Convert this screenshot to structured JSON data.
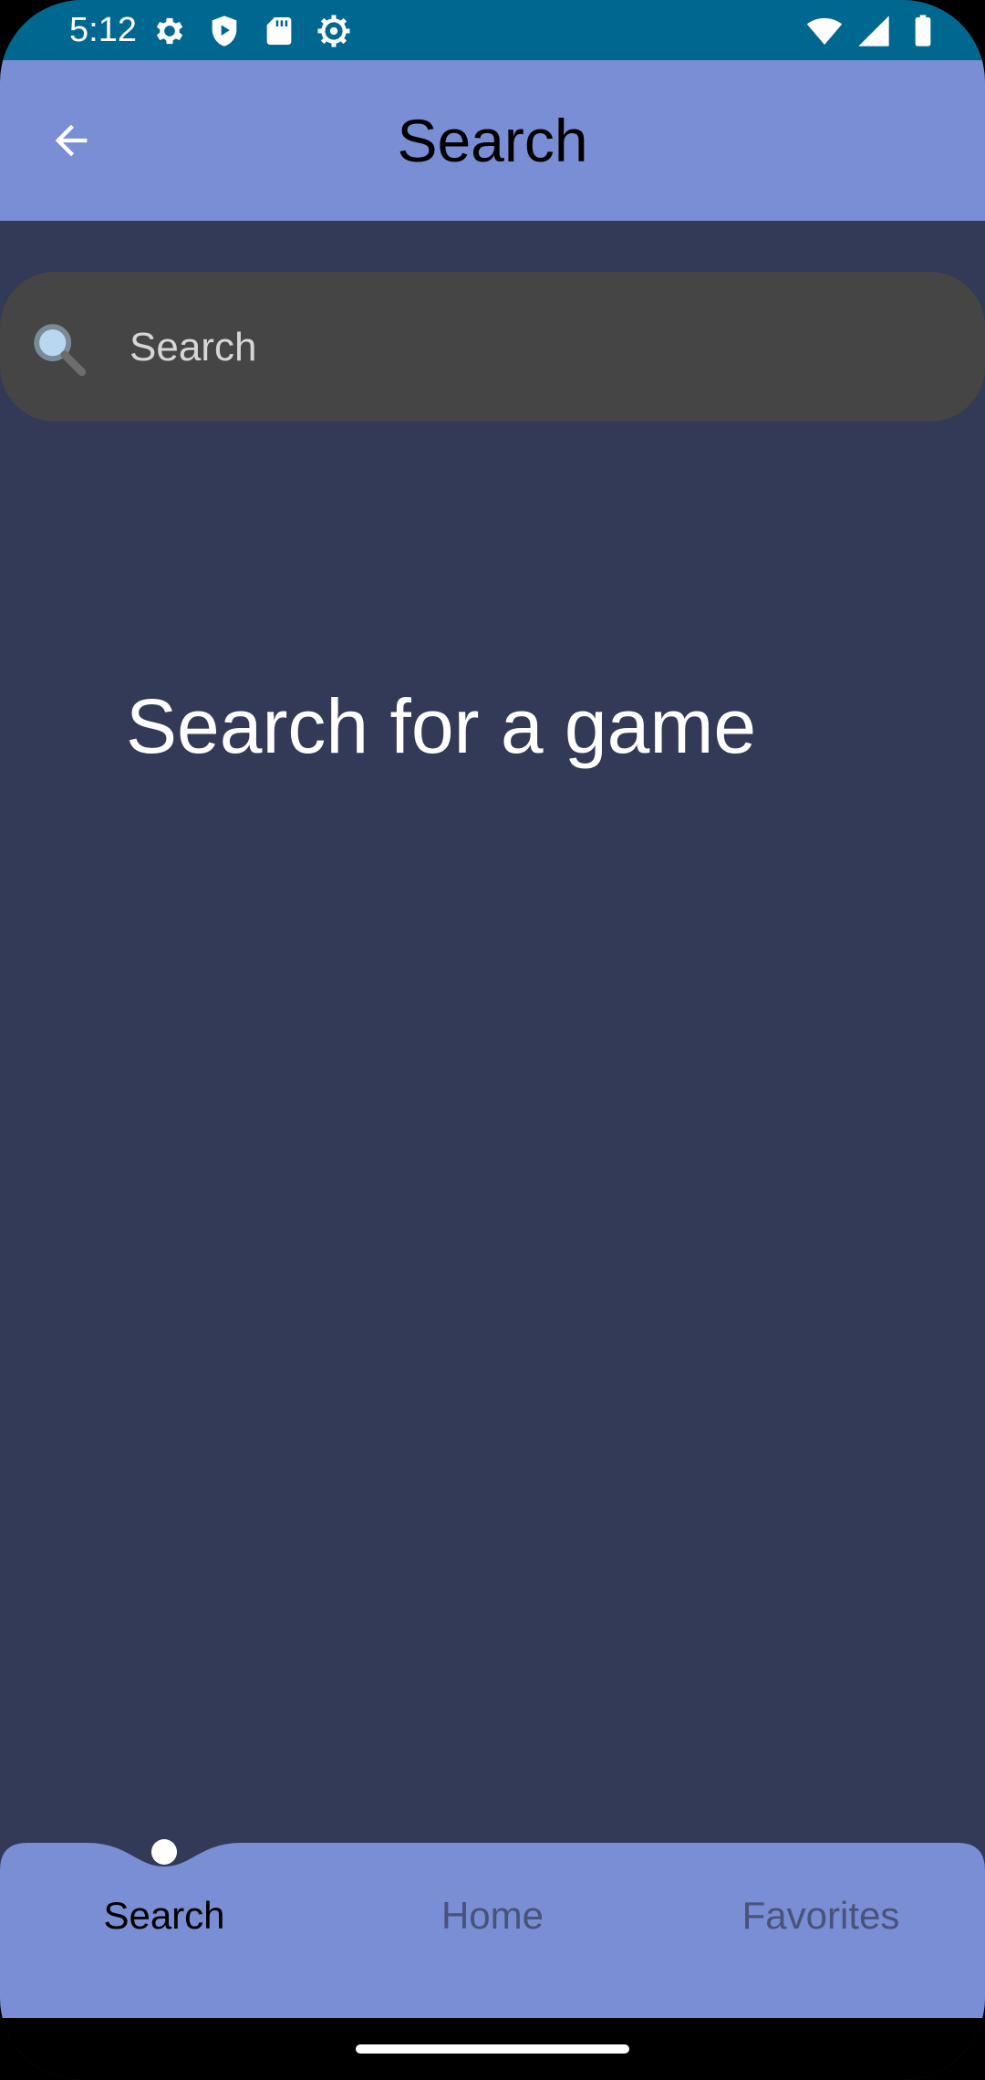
{
  "status_bar": {
    "time": "5:12",
    "left_icons": [
      "gear-icon",
      "shield-play-icon",
      "sd-card-icon",
      "settings-cog-icon"
    ],
    "right_icons": [
      "wifi-icon",
      "signal-icon",
      "battery-icon"
    ],
    "background": "#006790"
  },
  "app_bar": {
    "title": "Search",
    "back_icon": "arrow-left-icon",
    "background": "#7a8ed5"
  },
  "search": {
    "placeholder": "Search",
    "value": "",
    "icon": "magnifier-icon"
  },
  "main": {
    "empty_message": "Search for a game",
    "background": "#323a57"
  },
  "bottom_nav": {
    "items": [
      {
        "label": "Search",
        "active": true
      },
      {
        "label": "Home",
        "active": false
      },
      {
        "label": "Favorites",
        "active": false
      }
    ],
    "background": "#7a8ed5"
  }
}
